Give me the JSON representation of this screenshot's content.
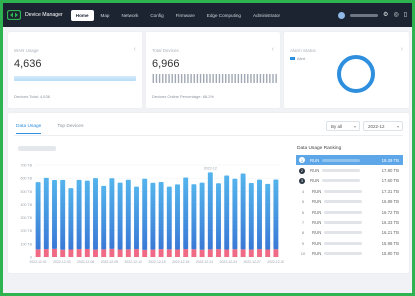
{
  "app": {
    "title": "Device Manager"
  },
  "nav": [
    {
      "label": "Home",
      "active": true
    },
    {
      "label": "Map",
      "active": false
    },
    {
      "label": "Network",
      "active": false
    },
    {
      "label": "Config",
      "active": false
    },
    {
      "label": "Firmware",
      "active": false
    },
    {
      "label": "Edge Computing",
      "active": false
    },
    {
      "label": "Administrator",
      "active": false
    }
  ],
  "topbar_icons": [
    "user-avatar-icon",
    "settings-icon",
    "help-icon",
    "notification-icon"
  ],
  "cards": {
    "card1": {
      "title": "WAN Usage",
      "value": "4,636",
      "footer": "Devices Total: 4,636"
    },
    "card2": {
      "title": "Total Devices",
      "value": "6,966",
      "footer": "Devices Online Percentage: 68.2%"
    },
    "card3": {
      "title": "Alarm Status",
      "legend": "Alert"
    }
  },
  "usage": {
    "tabs": [
      {
        "label": "Data Usage",
        "active": true
      },
      {
        "label": "Top Devices",
        "active": false
      }
    ],
    "select1": "By all",
    "select2": "2022-12",
    "ranking_title": "Data Usage Ranking",
    "ranking": [
      {
        "rank": "1",
        "name": "RUN",
        "value": "19.29 TB"
      },
      {
        "rank": "2",
        "name": "RUN",
        "value": "17.80 TB"
      },
      {
        "rank": "3",
        "name": "RUN",
        "value": "17.60 TB"
      },
      {
        "rank": "4",
        "name": "RUN",
        "value": "17.31 TB"
      },
      {
        "rank": "5",
        "name": "RUN",
        "value": "16.89 TB"
      },
      {
        "rank": "6",
        "name": "RUN",
        "value": "16.72 TB"
      },
      {
        "rank": "7",
        "name": "RUN",
        "value": "16.33 TB"
      },
      {
        "rank": "8",
        "name": "RUN",
        "value": "16.21 TB"
      },
      {
        "rank": "9",
        "name": "RUN",
        "value": "15.98 TB"
      },
      {
        "rank": "10",
        "name": "RUN",
        "value": "15.80 TB"
      }
    ]
  },
  "colors": {
    "accent": "#2e8fde",
    "topbar": "#1b2430",
    "bar_top": "#54b4ec",
    "bar_bottom": "#3a79d6",
    "bar_base": "#f06a86",
    "frame": "#2fb350"
  },
  "chart_data": {
    "type": "bar",
    "stacked": true,
    "title": "",
    "ylabel": "",
    "xlabel": "",
    "ylim": [
      0,
      700
    ],
    "yticks": [
      "700 TB",
      "600 TB",
      "500 TB",
      "400 TB",
      "300 TB",
      "200 TB",
      "100 TB",
      "0"
    ],
    "xticks": [
      "2022-12-01",
      "2022-12-03",
      "2022-12-06",
      "2022-12-09",
      "2022-12-12",
      "2022-12-15",
      "2022-12-18",
      "2022-12-21",
      "2022-12-24",
      "2022-12-27",
      "2022-12-30"
    ],
    "series": [
      {
        "values": [
          512,
          542,
          524,
          532,
          467,
          527,
          520,
          544,
          483,
          537,
          509,
          530,
          475,
          541,
          509,
          511,
          477,
          496,
          545,
          495,
          511,
          586,
          501,
          563,
          536,
          577,
          507,
          529,
          499,
          531
        ]
      },
      {
        "values": [
          58,
          60,
          62,
          55,
          57,
          60,
          61,
          56,
          58,
          62,
          57,
          58,
          60,
          54,
          56,
          60,
          58,
          57,
          60,
          59,
          55,
          58,
          60,
          57,
          59,
          58,
          56,
          60,
          57,
          59
        ]
      }
    ],
    "annotation": "2022-12"
  }
}
